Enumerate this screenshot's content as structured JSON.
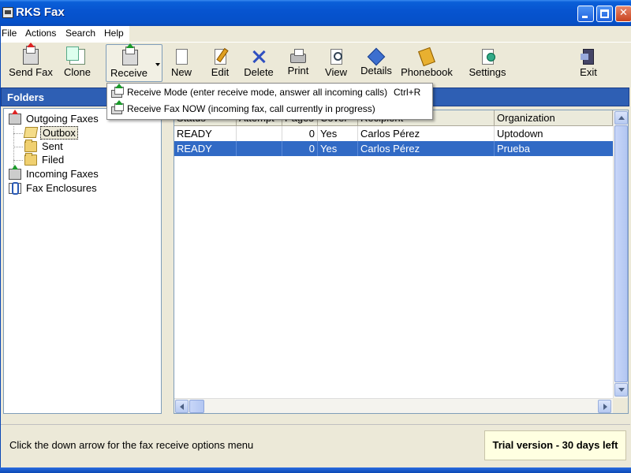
{
  "window": {
    "title": "RKS Fax"
  },
  "menubar": [
    "File",
    "Actions",
    "Search",
    "Help"
  ],
  "toolbar": {
    "send_fax": "Send Fax",
    "clone": "Clone",
    "receive": "Receive",
    "new": "New",
    "edit": "Edit",
    "delete": "Delete",
    "print": "Print",
    "view": "View",
    "details": "Details",
    "phonebook": "Phonebook",
    "settings": "Settings",
    "exit": "Exit"
  },
  "receive_menu": [
    {
      "label": "Receive Mode (enter receive mode, answer all incoming calls)",
      "shortcut": "Ctrl+R"
    },
    {
      "label": "Receive Fax NOW (incoming fax, call currently in progress)",
      "shortcut": ""
    }
  ],
  "folders": {
    "title": "Folders",
    "tree": {
      "outgoing": "Outgoing Faxes",
      "outbox": "Outbox",
      "sent": "Sent",
      "filed": "Filed",
      "incoming": "Incoming Faxes",
      "enclosures": "Fax Enclosures"
    }
  },
  "list": {
    "columns": [
      "Status",
      "Attempt",
      "Pages",
      "Cover",
      "Recipient",
      "Organization"
    ],
    "rows": [
      {
        "status": "READY",
        "attempt": "",
        "pages": "0",
        "cover": "Yes",
        "recipient": "Carlos Pérez",
        "organization": "Uptodown",
        "selected": false
      },
      {
        "status": "READY",
        "attempt": "",
        "pages": "0",
        "cover": "Yes",
        "recipient": "Carlos Pérez",
        "organization": "Prueba",
        "selected": true
      }
    ]
  },
  "statusbar": {
    "message": "Click the down arrow for the fax receive options menu",
    "trial": "Trial version - 30 days left"
  },
  "colors": {
    "title_bar": "#0754d0",
    "selection": "#316ac5",
    "folders_header": "#2e5fb4",
    "trial_bg": "#ffffe1"
  }
}
